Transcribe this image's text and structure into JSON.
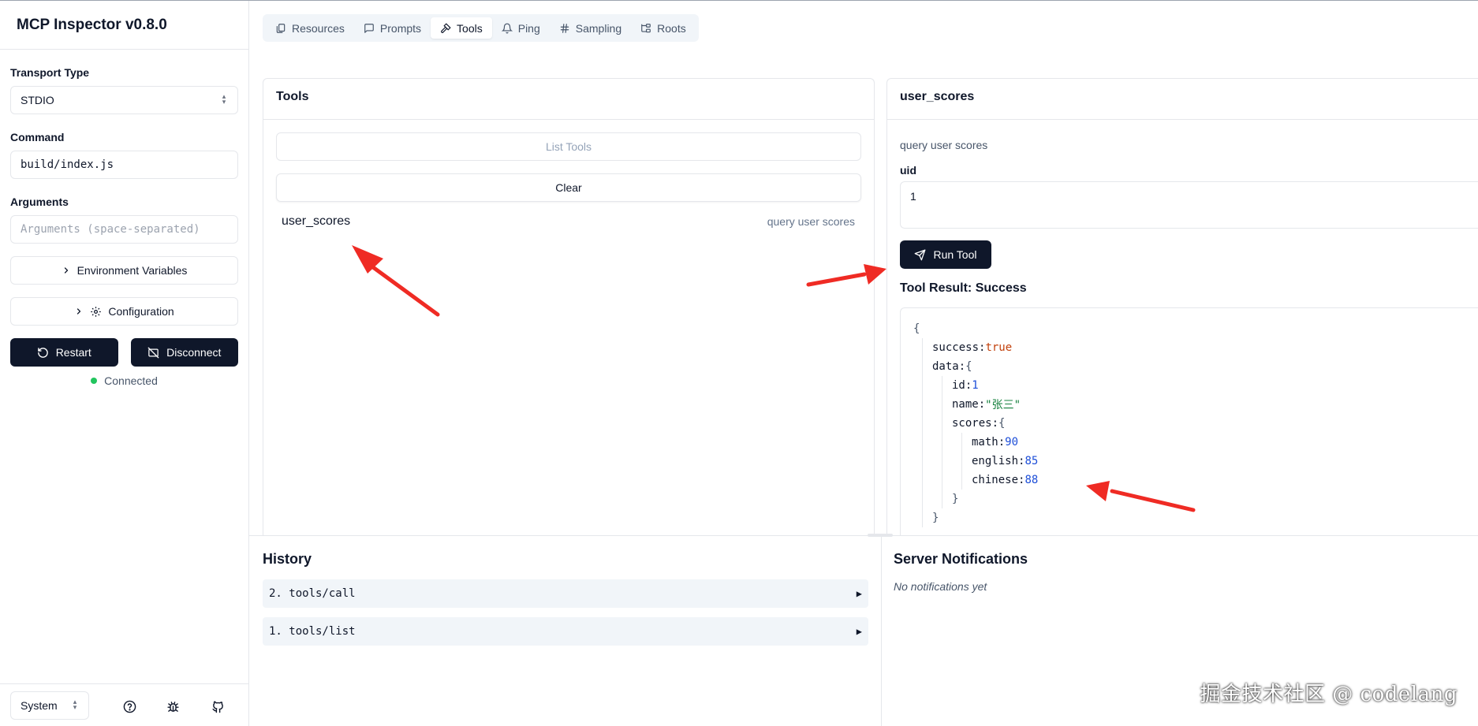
{
  "app_title": "MCP Inspector v0.8.0",
  "sidebar": {
    "transport_label": "Transport Type",
    "transport_value": "STDIO",
    "command_label": "Command",
    "command_value": "build/index.js",
    "arguments_label": "Arguments",
    "arguments_placeholder": "Arguments (space-separated)",
    "env_button": "Environment Variables",
    "config_button": "Configuration",
    "restart_button": "Restart",
    "disconnect_button": "Disconnect",
    "status": "Connected",
    "status_color": "#22c55e",
    "theme_value": "System"
  },
  "tabs": [
    {
      "label": "Resources",
      "icon": "files-icon"
    },
    {
      "label": "Prompts",
      "icon": "message-icon"
    },
    {
      "label": "Tools",
      "icon": "hammer-icon",
      "active": true
    },
    {
      "label": "Ping",
      "icon": "bell-icon"
    },
    {
      "label": "Sampling",
      "icon": "hash-icon"
    },
    {
      "label": "Roots",
      "icon": "folder-tree-icon"
    }
  ],
  "tools_panel": {
    "title": "Tools",
    "list_button": "List Tools",
    "clear_button": "Clear",
    "tools": [
      {
        "name": "user_scores",
        "description": "query user scores"
      }
    ]
  },
  "tool_detail": {
    "title": "user_scores",
    "description": "query user scores",
    "param_label": "uid",
    "param_value": "1",
    "run_button": "Run Tool",
    "result_title": "Tool Result: Success",
    "result": {
      "open": "{",
      "success_key": "success:",
      "success_val": "true",
      "data_key": "data:",
      "data_open": "{",
      "id_key": "id:",
      "id_val": "1",
      "name_key": "name:",
      "name_val": "\"张三\"",
      "scores_key": "scores:",
      "scores_open": "{",
      "math_key": "math:",
      "math_val": "90",
      "english_key": "english:",
      "english_val": "85",
      "chinese_key": "chinese:",
      "chinese_val": "88",
      "scores_close": "}",
      "data_close": "}"
    }
  },
  "history": {
    "title": "History",
    "items": [
      {
        "label": "2. tools/call"
      },
      {
        "label": "1. tools/list"
      }
    ]
  },
  "notifications": {
    "title": "Server Notifications",
    "empty_text": "No notifications yet"
  },
  "watermark": "掘金技术社区 @ codelang",
  "annotation_color": "#ef2b24"
}
